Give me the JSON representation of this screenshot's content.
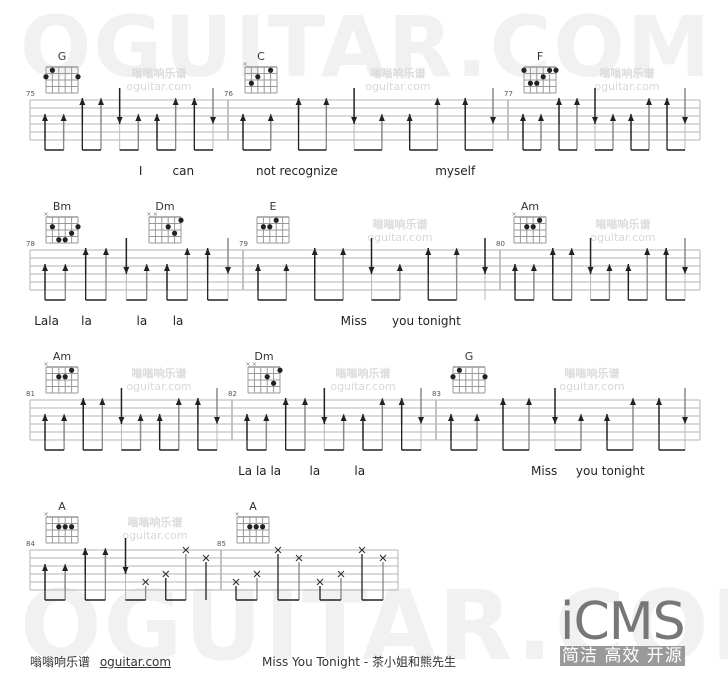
{
  "watermark": {
    "big_text": "OGUITAR.COM",
    "site_cn": "嗡嗡响乐谱",
    "site_url": "oguitar.com"
  },
  "colors": {
    "staff_line": "#b4b4b4",
    "stroke_dark": "#222222",
    "stroke_gray": "#888888",
    "watermark": "#f1f1f1"
  },
  "rows": [
    {
      "measures": [
        {
          "number": "75",
          "chord": "G",
          "strokes": [
            "u",
            "u",
            "U",
            "U",
            "D",
            "u",
            "u",
            "U",
            "U",
            "D"
          ],
          "lyrics": [
            {
              "text": "I",
              "pos": 0.55
            },
            {
              "text": "can",
              "pos": 0.72
            }
          ]
        },
        {
          "number": "76",
          "chord": "C",
          "strokes": [
            "u",
            "u",
            "U",
            "U",
            "D",
            "u",
            "u",
            "U",
            "U",
            "D"
          ],
          "lyrics": [
            {
              "text": "not recognize",
              "pos": 0.1
            },
            {
              "text": "myself",
              "pos": 0.74
            }
          ]
        },
        {
          "number": "77",
          "chord": "F",
          "strokes": [
            "u",
            "u",
            "U",
            "U",
            "D",
            "u",
            "u",
            "U",
            "U",
            "D"
          ],
          "lyrics": []
        }
      ]
    },
    {
      "measures": [
        {
          "number": "78",
          "chord": "Bm",
          "chord2": "Dm",
          "strokes": [
            "u",
            "u",
            "U",
            "U",
            "D",
            "u",
            "u",
            "U",
            "U",
            "D"
          ],
          "lyrics": [
            {
              "text": "Lala",
              "pos": 0.02
            },
            {
              "text": "la",
              "pos": 0.24
            },
            {
              "text": "la",
              "pos": 0.5
            },
            {
              "text": "la",
              "pos": 0.67
            }
          ]
        },
        {
          "number": "79",
          "chord": "E",
          "strokes": [
            "u",
            "u",
            "U",
            "U",
            "D",
            "u",
            "U",
            "U",
            "D"
          ],
          "lyrics": [
            {
              "text": "Miss",
              "pos": 0.38
            },
            {
              "text": "you tonight",
              "pos": 0.58
            }
          ]
        },
        {
          "number": "80",
          "chord": "Am",
          "strokes": [
            "u",
            "u",
            "U",
            "U",
            "D",
            "u",
            "u",
            "U",
            "U",
            "D"
          ],
          "lyrics": []
        }
      ]
    },
    {
      "measures": [
        {
          "number": "81",
          "chord": "Am",
          "strokes": [
            "u",
            "u",
            "U",
            "U",
            "D",
            "u",
            "u",
            "U",
            "U",
            "D"
          ],
          "lyrics": []
        },
        {
          "number": "82",
          "chord": "Dm",
          "strokes": [
            "u",
            "u",
            "U",
            "U",
            "D",
            "u",
            "u",
            "U",
            "U",
            "D"
          ],
          "lyrics": [
            {
              "text": "La la la",
              "pos": 0.03
            },
            {
              "text": "la",
              "pos": 0.38
            },
            {
              "text": "la",
              "pos": 0.6
            }
          ]
        },
        {
          "number": "83",
          "chord": "G",
          "strokes": [
            "u",
            "u",
            "U",
            "U",
            "D",
            "u",
            "u",
            "U",
            "U",
            "D"
          ],
          "lyrics": [
            {
              "text": "Miss",
              "pos": 0.36
            },
            {
              "text": "you tonight",
              "pos": 0.53
            }
          ]
        }
      ]
    },
    {
      "measures": [
        {
          "number": "84",
          "chord": "A",
          "strokes": [
            "u",
            "u",
            "U",
            "U",
            "D",
            "x4",
            "x3",
            "x1",
            "x2"
          ],
          "lyrics": []
        },
        {
          "number": "85",
          "chord": "A",
          "strokes": [
            "x4",
            "x3",
            "x1",
            "x2",
            "x4",
            "x3",
            "x1",
            "x2"
          ],
          "lyrics": []
        }
      ]
    }
  ],
  "chords": {
    "G": {
      "muted": [],
      "dots": [
        [
          0,
          1
        ],
        [
          5,
          2
        ],
        [
          1,
          1
        ]
      ],
      "dots_fixed": [
        [
          1,
          1
        ],
        [
          0,
          2
        ],
        [
          5,
          2
        ]
      ]
    },
    "C": {
      "muted": [
        0
      ],
      "dots": [
        [
          4,
          1
        ],
        [
          2,
          2
        ],
        [
          1,
          3
        ]
      ]
    },
    "F": {
      "muted": [],
      "dots": [
        [
          0,
          1
        ],
        [
          4,
          1
        ],
        [
          5,
          1
        ],
        [
          3,
          2
        ],
        [
          1,
          3
        ],
        [
          2,
          3
        ]
      ]
    },
    "Bm": {
      "muted": [
        0
      ],
      "dots": [
        [
          1,
          2
        ],
        [
          5,
          2
        ],
        [
          4,
          3
        ],
        [
          2,
          4
        ],
        [
          3,
          4
        ]
      ]
    },
    "Dm": {
      "muted": [
        0,
        1
      ],
      "dots": [
        [
          5,
          1
        ],
        [
          3,
          2
        ],
        [
          4,
          3
        ]
      ]
    },
    "E": {
      "muted": [],
      "dots": [
        [
          3,
          1
        ],
        [
          1,
          2
        ],
        [
          2,
          2
        ]
      ]
    },
    "Am": {
      "muted": [
        0
      ],
      "dots": [
        [
          4,
          1
        ],
        [
          2,
          2
        ],
        [
          3,
          2
        ]
      ]
    },
    "A": {
      "muted": [
        0
      ],
      "dots": [
        [
          2,
          2
        ],
        [
          3,
          2
        ],
        [
          4,
          2
        ]
      ]
    }
  },
  "footer": {
    "site_cn": "嗡嗡响乐谱",
    "site_url": "oguitar.com",
    "song_title": "Miss You Tonight - 茶小姐和熊先生"
  },
  "icms": {
    "logo": "iCMS",
    "tagline": "简洁 高效 开源"
  }
}
